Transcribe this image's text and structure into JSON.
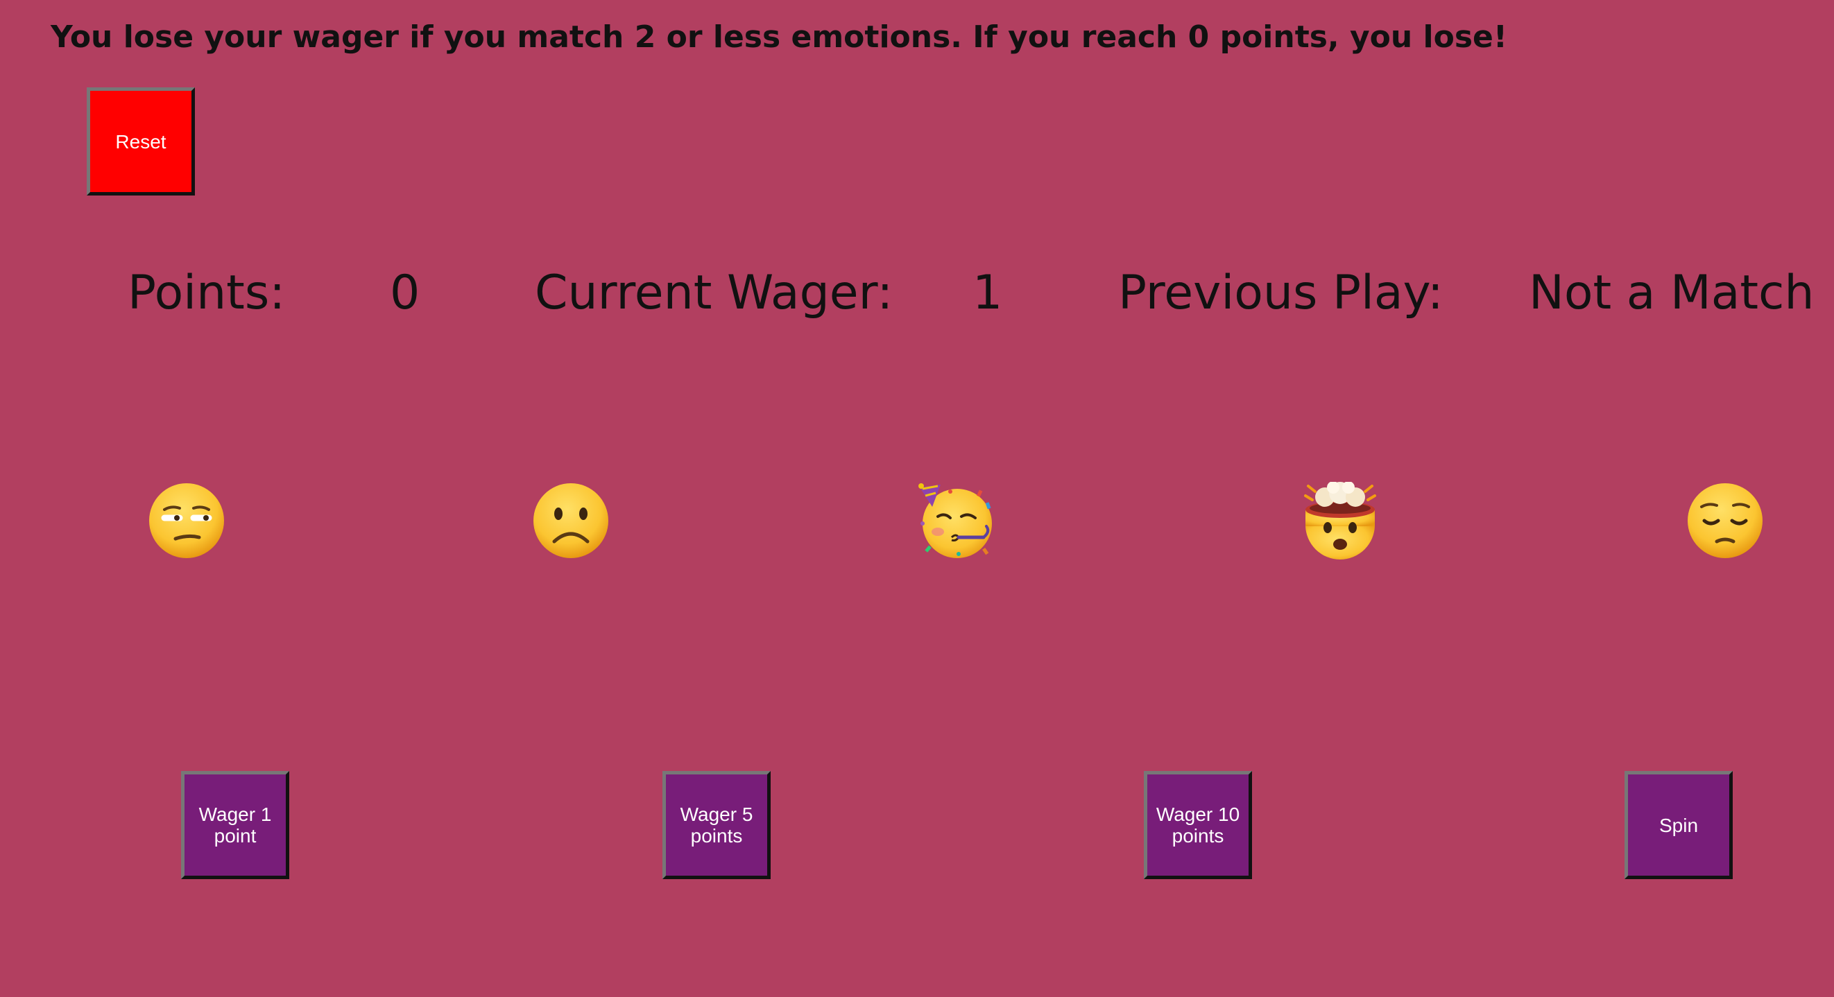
{
  "instructions": "You lose your wager if you match 2 or less emotions. If you reach 0 points, you lose!",
  "buttons": {
    "reset": "Reset",
    "wager1": "Wager 1 point",
    "wager5": "Wager 5 points",
    "wager10": "Wager 10 points",
    "spin": "Spin"
  },
  "status": {
    "points_label": "Points:",
    "points_value": "0",
    "wager_label": "Current Wager:",
    "wager_value": "1",
    "previous_label": "Previous Play:",
    "previous_value": "Not a Match"
  },
  "reels": [
    "unamused-face-icon",
    "frowning-face-icon",
    "partying-face-icon",
    "exploding-head-icon",
    "pensive-face-icon"
  ],
  "colors": {
    "background": "#b23f60",
    "reset_button": "#ff0000",
    "wager_button": "#781d79",
    "emoji_yellow": "#fbc531"
  }
}
